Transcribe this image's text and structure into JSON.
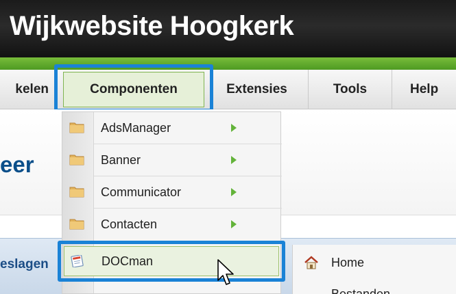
{
  "header": {
    "site_title": "Wijkwebsite Hoogkerk"
  },
  "menubar": {
    "items": [
      {
        "label": "kelen"
      },
      {
        "label": "Componenten"
      },
      {
        "label": "Extensies"
      },
      {
        "label": "Tools"
      },
      {
        "label": "Help"
      }
    ]
  },
  "page": {
    "heading_fragment": "eer",
    "toolbar_fragment": "eslagen"
  },
  "dropdown": {
    "items": [
      {
        "label": "AdsManager",
        "icon": "folder-icon",
        "has_submenu": true
      },
      {
        "label": "Banner",
        "icon": "folder-icon",
        "has_submenu": true
      },
      {
        "label": "Communicator",
        "icon": "folder-icon",
        "has_submenu": true
      },
      {
        "label": "Contacten",
        "icon": "folder-icon",
        "has_submenu": true
      },
      {
        "label": "DOCman",
        "icon": "docman-icon",
        "has_submenu": true
      }
    ]
  },
  "submenu": {
    "items": [
      {
        "label": "Home",
        "icon": "home-icon"
      },
      {
        "label": "Bestanden"
      }
    ]
  },
  "colors": {
    "header_bg": "#1b1b1b",
    "green_bar": "#63a82e",
    "highlight_border": "#1a82d6",
    "heading_blue": "#0b4f8a",
    "submenu_arrow": "#63b33a"
  }
}
